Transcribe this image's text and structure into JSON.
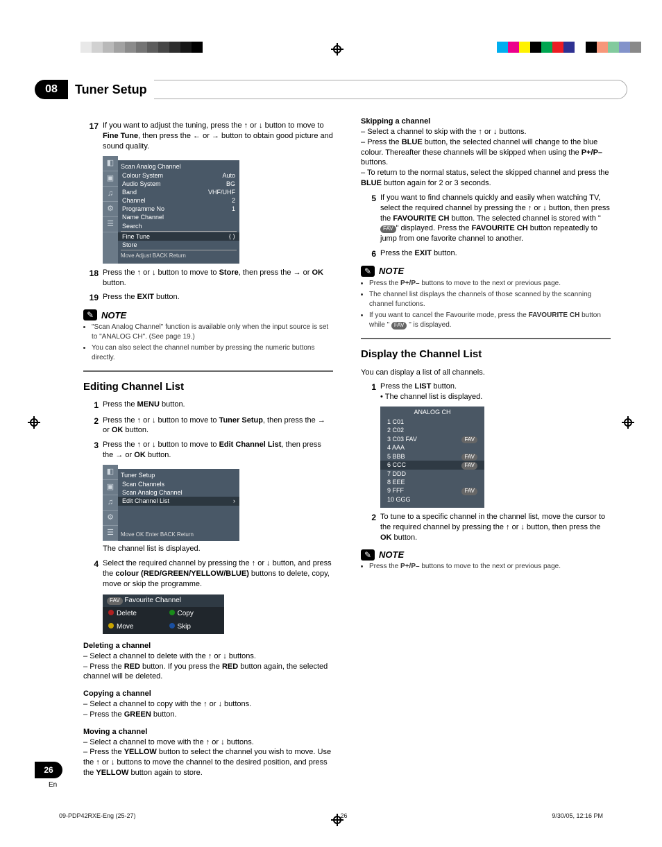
{
  "chapter": {
    "num": "08",
    "title": "Tuner Setup"
  },
  "left": {
    "step17": {
      "num": "17",
      "text_a": "If you want to adjust the tuning, press the ",
      "text_b": " or ",
      "text_c": " button to move to ",
      "fine_tune": "Fine Tune",
      "text_d": ", then press the ",
      "text_e": " or ",
      "text_f": " button to obtain good picture and sound quality."
    },
    "osd1": {
      "title": "Scan Analog Channel",
      "rows": [
        {
          "l": "Colour System",
          "r": "Auto"
        },
        {
          "l": "Audio System",
          "r": "BG"
        },
        {
          "l": "Band",
          "r": "VHF/UHF"
        },
        {
          "l": "Channel",
          "r": "2"
        },
        {
          "l": "Programme No",
          "r": "1"
        },
        {
          "l": "Name Channel",
          "r": ""
        },
        {
          "l": "Search",
          "r": ""
        }
      ],
      "sel_row": {
        "l": "Fine Tune",
        "r": "⟨ ⟩"
      },
      "store": "Store",
      "hint": "Move     Adjust     BACK Return"
    },
    "step18": {
      "num": "18",
      "text_a": "Press the ",
      "text_b": " or ",
      "text_c": " button to move to ",
      "store": "Store",
      "text_d": ", then press the ",
      "text_e": " or ",
      "ok": "OK",
      "text_f": " button."
    },
    "step19": {
      "num": "19",
      "text_a": "Press the ",
      "exit": "EXIT",
      "text_b": " button."
    },
    "note1_label": "NOTE",
    "note1": [
      "\"Scan Analog Channel\" function is available only when the input source is set to \"ANALOG CH\". (See page 19.)",
      "You can also select the channel number by pressing the numeric buttons directly."
    ],
    "edit_hdr": "Editing Channel List",
    "edit_steps": {
      "s1": {
        "num": "1",
        "a": "Press the ",
        "menu": "MENU",
        "b": " button."
      },
      "s2": {
        "num": "2",
        "a": "Press the ",
        "b": " or ",
        "c": " button to move to ",
        "tuner": "Tuner Setup",
        "d": ", then press the ",
        "e": " or ",
        "ok": "OK",
        "f": " button."
      },
      "s3": {
        "num": "3",
        "a": "Press the ",
        "b": " or ",
        "c": " button to move to ",
        "ecl": "Edit Channel List",
        "d": ", then press the ",
        "e": " or ",
        "ok": "OK",
        "f": " button."
      }
    },
    "osd2": {
      "title": "Tuner Setup",
      "rows": [
        "Scan Channels",
        "Scan Analog Channel",
        "Edit Channel List"
      ],
      "hint": "Move     OK Enter     BACK Return"
    },
    "after_osd2": "The channel list is displayed.",
    "s4": {
      "num": "4",
      "a": "Select the required channel by pressing the ",
      "b": " or ",
      "c": " button, and press the ",
      "colour": "colour (RED/GREEN/YELLOW/BLUE)",
      "d": " buttons to delete, copy, move or skip the programme."
    },
    "fav_table": {
      "top_badge": "FAV",
      "top_text": "Favourite Channel",
      "cells": [
        {
          "dot": "#b02020",
          "t": "Delete"
        },
        {
          "dot": "#1a8a1a",
          "t": "Copy"
        },
        {
          "dot": "#c9a300",
          "t": "Move"
        },
        {
          "dot": "#1a4fa0",
          "t": "Skip"
        }
      ]
    },
    "del_hdr": "Deleting a channel",
    "del_a": "Select a channel to delete with the ",
    "del_b": " or ",
    "del_c": " buttons.",
    "del2_a": "Press the ",
    "del2_red": "RED",
    "del2_b": " button. If you press the ",
    "del2_c": " button again, the selected channel will be deleted.",
    "copy_hdr": "Copying a channel",
    "copy_a": "Select a channel to copy with the ",
    "copy_b": " or ",
    "copy_c": " buttons.",
    "copy2_a": "Press the ",
    "copy2_green": "GREEN",
    "copy2_b": " button.",
    "move_hdr": "Moving a channel",
    "move_a": "Select a channel to move with the ",
    "move_b": " or ",
    "move_c": " buttons.",
    "move2_a": "Press the ",
    "move2_yellow": "YELLOW",
    "move2_b": " button to select the channel you wish to move. Use the ",
    "move2_c": " or ",
    "move2_d": " buttons to move the channel to the desired position, and press the ",
    "move2_e": " button again to store."
  },
  "right": {
    "skip_hdr": "Skipping a channel",
    "skip_a": "Select a channel to skip with the ",
    "skip_b": " or ",
    "skip_c": " buttons.",
    "skip2_a": "Press the ",
    "skip2_blue": "BLUE",
    "skip2_b": " button, the selected channel will change to the blue colour. Thereafter these channels will be skipped when using the ",
    "skip2_pp": "P+/P–",
    "skip2_c": " buttons.",
    "skip3_a": "To return to the normal status, select the skipped channel and press the ",
    "skip3_b": " button again for 2 or 3 seconds.",
    "s5": {
      "num": "5",
      "a": "If you want to find channels quickly and easily when watching TV, select the required channel by pressing the ",
      "b": " or ",
      "c": " button, then press the ",
      "favch": "FAVOURITE CH",
      "d": " button. The selected channel is stored with \"",
      "fav": "FAV",
      "e": "\" displayed. Press the ",
      "f": " button repeatedly to jump from one favorite channel to another."
    },
    "s6": {
      "num": "6",
      "a": "Press the ",
      "exit": "EXIT",
      "b": " button."
    },
    "note_label": "NOTE",
    "note2": [
      "Press the P+/P– buttons to move to the next or previous page.",
      "The channel list displays the channels of those scanned by the scanning channel functions.",
      "If you want to cancel the Favourite mode, press the FAVOURITE CH button while \" FAV \" is displayed."
    ],
    "disp_hdr": "Display the Channel List",
    "disp_sub": "You can display a list of all channels.",
    "d1": {
      "num": "1",
      "a": "Press the ",
      "list": "LIST",
      "b": " button.",
      "bullet": "The channel list is displayed."
    },
    "list_osd": {
      "title": "ANALOG CH",
      "rows": [
        {
          "n": "1",
          "t": "C01",
          "fav": false
        },
        {
          "n": "2",
          "t": "C02",
          "fav": false
        },
        {
          "n": "3",
          "t": "C03 FAV",
          "fav": true
        },
        {
          "n": "4",
          "t": "AAA",
          "fav": false
        },
        {
          "n": "5",
          "t": "BBB",
          "fav": true
        },
        {
          "n": "6",
          "t": "CCC",
          "fav": true,
          "sel": true
        },
        {
          "n": "7",
          "t": "DDD",
          "fav": false
        },
        {
          "n": "8",
          "t": "EEE",
          "fav": false
        },
        {
          "n": "9",
          "t": "FFF",
          "fav": true
        },
        {
          "n": "10",
          "t": "GGG",
          "fav": false
        }
      ]
    },
    "d2": {
      "num": "2",
      "a": "To tune to a specific channel in the channel list, move the cursor to the required channel by pressing the ",
      "b": " or ",
      "c": " button, then press the ",
      "ok": "OK",
      "d": " button."
    },
    "note3_label": "NOTE",
    "note3": "Press the P+/P– buttons to move to the next or previous page."
  },
  "page": {
    "num": "26",
    "lang": "En"
  },
  "footer": {
    "left": "09-PDP42RXE-Eng (25-27)",
    "mid": "26",
    "right": "9/30/05, 12:16 PM"
  },
  "arrows": {
    "up": "↑",
    "down": "↓",
    "left": "←",
    "right": "→"
  }
}
